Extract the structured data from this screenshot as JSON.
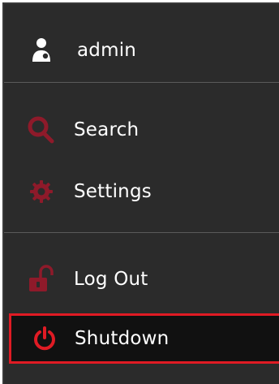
{
  "menu": {
    "user": {
      "label": "admin",
      "icon": "user-icon"
    },
    "items": [
      {
        "label": "Search",
        "icon": "search-icon"
      },
      {
        "label": "Settings",
        "icon": "gear-icon"
      },
      {
        "label": "Log Out",
        "icon": "unlock-icon"
      },
      {
        "label": "Shutdown",
        "icon": "power-icon",
        "selected": true
      }
    ]
  },
  "colors": {
    "background": "#2b2b2b",
    "accent_red": "#e01b24",
    "icon_dark_red": "#8e1a2a",
    "text": "#ffffff"
  }
}
